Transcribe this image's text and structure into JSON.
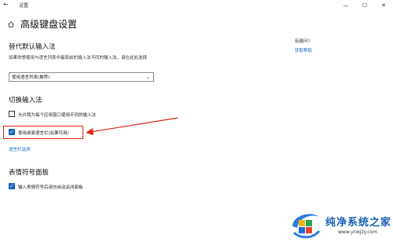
{
  "window": {
    "app_title": "设置",
    "back_icon": "back-arrow-icon",
    "controls": [
      "minimize-icon",
      "maximize-icon",
      "close-icon"
    ]
  },
  "page": {
    "title": "高级键盘设置",
    "title_icon": "home-icon"
  },
  "override_default": {
    "heading": "替代默认输入法",
    "description": "如果你想使用与语言列表中最靠前的输入法不同的输入法，请在此处选择",
    "select_value": "使用语言列表(推荐)"
  },
  "switch_input": {
    "heading": "切换输入法",
    "option1": {
      "label": "允许我为每个应用窗口使用不同的输入法",
      "checked": false
    },
    "option2": {
      "label": "使用桌面语言栏(如果可用)",
      "checked": true
    },
    "link": "语言栏选项",
    "highlight_color": "#e0241b"
  },
  "emoji_panel": {
    "heading": "表情符号面板",
    "option": {
      "label": "输入表情符号后请勿自动关闭面板",
      "checked": true
    }
  },
  "help": {
    "title": "有疑问?",
    "link": "获取帮助"
  },
  "watermark": {
    "text": "纯净系统之家",
    "url": "www.ycwjzy.com"
  },
  "colors": {
    "accent": "#1565c0",
    "link": "#1a66c7"
  }
}
